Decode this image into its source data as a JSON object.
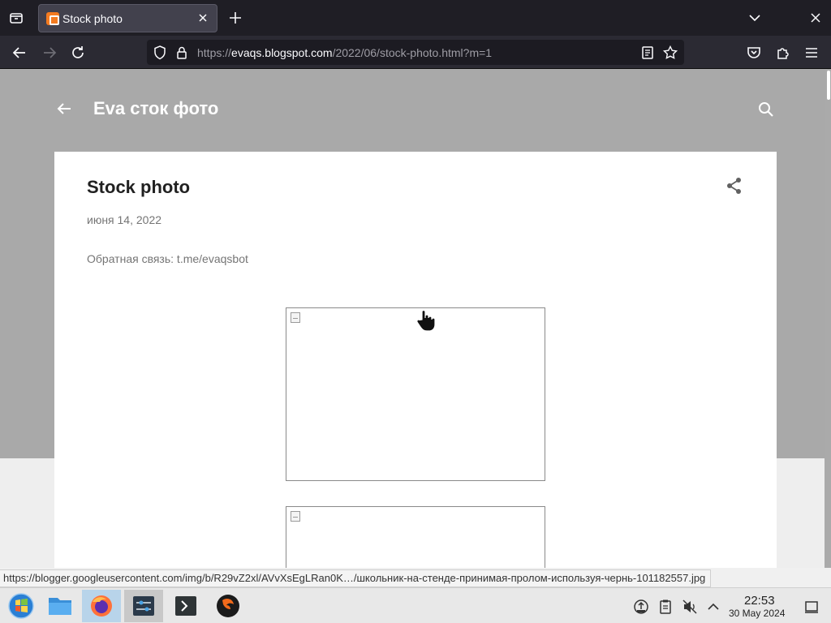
{
  "browser": {
    "tab_title": "Stock photo",
    "url_prefix": "https://",
    "url_host": "evaqs.blogspot.com",
    "url_path": "/2022/06/stock-photo.html?m=1"
  },
  "blog": {
    "name": "Eva сток фото"
  },
  "post": {
    "title": "Stock photo",
    "date": "июня 14, 2022",
    "feedback": "Обратная связь: t.me/evaqsbot"
  },
  "status_url": "https://blogger.googleusercontent.com/img/b/R29vZ2xl/AVvXsEgLRan0K…/школьник-на-стенде-принимая-пролом-используя-чернь-101182557.jpg",
  "taskbar": {
    "time": "22:53",
    "date": "30 May 2024",
    "apps": [
      "start-menu",
      "file-manager",
      "firefox",
      "settings",
      "terminal",
      "app"
    ]
  },
  "colors": {
    "chrome_dark": "#1f1e25",
    "toolbar": "#2b2a33",
    "header_grey": "#a9a9a9",
    "blogger_orange": "#f47b20"
  }
}
